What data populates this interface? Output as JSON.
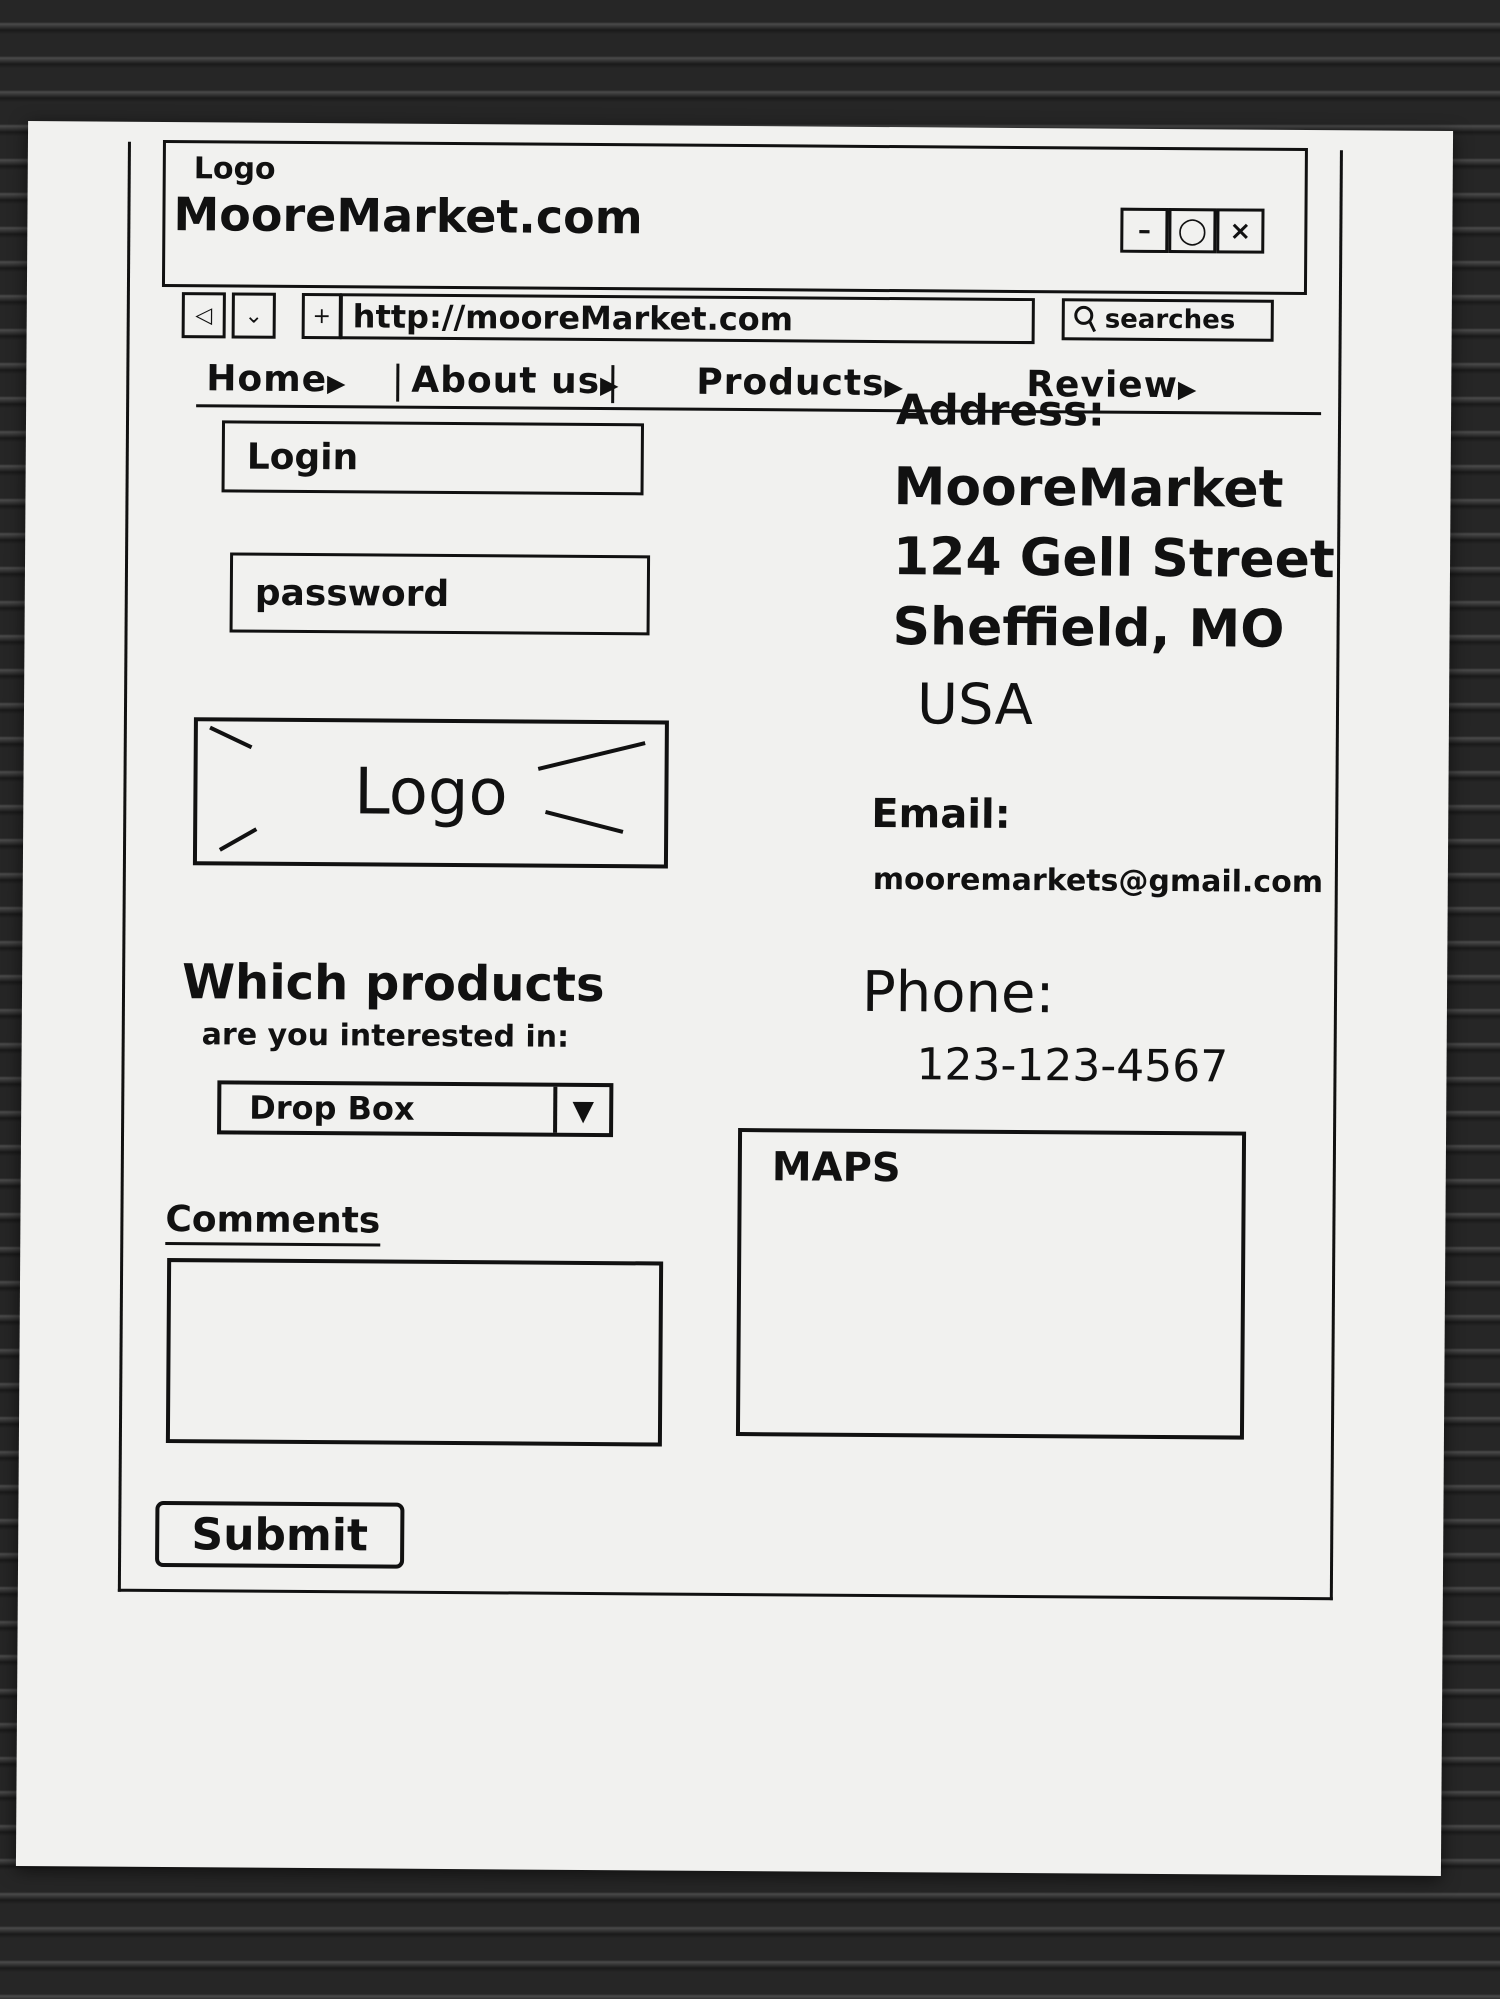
{
  "window": {
    "logo_label": "Logo",
    "title": "MooreMarket.com",
    "minimize_glyph": "–",
    "maximize_glyph": "◯",
    "close_glyph": "×"
  },
  "browser": {
    "back_glyph": "◁",
    "dropdown_glyph": "⌄",
    "plus_glyph": "+",
    "url": "http://mooreMarket.com",
    "search_label": "searches",
    "search_icon": "magnifier-icon"
  },
  "nav": {
    "items": [
      {
        "label": "Home",
        "arrow": "▶"
      },
      {
        "label": "About us",
        "arrow": "▶"
      },
      {
        "label": "Products",
        "arrow": "▶"
      },
      {
        "label": "Review",
        "arrow": "▶"
      }
    ]
  },
  "form": {
    "login_label": "Login",
    "password_label": "password",
    "logo_label": "Logo",
    "question_line1": "Which products",
    "question_line2": "are you interested in:",
    "dropbox_label": "Drop Box",
    "dropbox_arrow": "▼",
    "comments_label": "Comments",
    "submit_label": "Submit"
  },
  "contact": {
    "address_heading": "Address:",
    "address_lines": [
      "MooreMarket",
      "124 Gell Street",
      "Sheffield, MO",
      "USA"
    ],
    "email_heading": "Email:",
    "email": "mooremarkets@gmail.com",
    "phone_heading": "Phone:",
    "phone": "123-123-4567"
  },
  "maps": {
    "label": "MAPS"
  }
}
